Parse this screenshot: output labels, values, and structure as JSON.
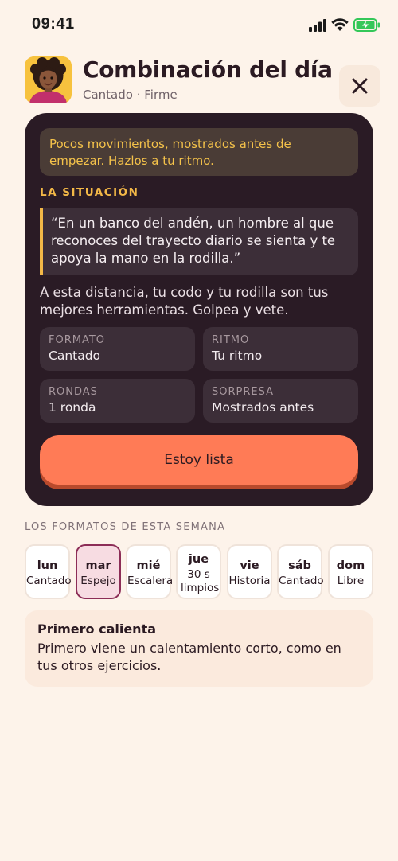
{
  "status_bar": {
    "time": "09:41"
  },
  "header": {
    "title": "Combinación del día",
    "subtitle": "Cantado · Firme",
    "close_icon": "close-icon",
    "avatar_icon": "avatar"
  },
  "card": {
    "tip": "Pocos movimientos, mostrados antes de empezar. Hazlos a tu ritmo.",
    "situation_label": "LA SITUACIÓN",
    "quote": "“En un banco del andén, un hombre al que reconoces del trayecto diario se sienta y te apoya la mano en la rodilla.”",
    "body": "A esta distancia, tu codo y tu rodilla son tus mejores herramientas. Golpea y vete.",
    "tiles": [
      {
        "label": "FORMATO",
        "value": "Cantado"
      },
      {
        "label": "RITMO",
        "value": "Tu ritmo"
      },
      {
        "label": "RONDAS",
        "value": "1 ronda"
      },
      {
        "label": "SORPRESA",
        "value": "Mostrados antes"
      }
    ],
    "button_label": "Estoy lista"
  },
  "week": {
    "label": "LOS FORMATOS DE ESTA SEMANA",
    "days": [
      {
        "name": "lun",
        "format": "Cantado"
      },
      {
        "name": "mar",
        "format": "Espejo",
        "selected": true
      },
      {
        "name": "mié",
        "format": "Escalera"
      },
      {
        "name": "jue",
        "format": "30 s limpios"
      },
      {
        "name": "vie",
        "format": "Historia"
      },
      {
        "name": "sáb",
        "format": "Cantado"
      },
      {
        "name": "dom",
        "format": "Libre"
      }
    ]
  },
  "info": {
    "title": "Primero calienta",
    "text": "Primero viene un calentamiento corto, como en tus otros ejercicios."
  },
  "colors": {
    "background": "#fdf3ea",
    "card": "#2a1b25",
    "accent": "#ff7b56",
    "highlight": "#f3b847",
    "selected": "#8c2d57",
    "battery": "#34c759"
  }
}
